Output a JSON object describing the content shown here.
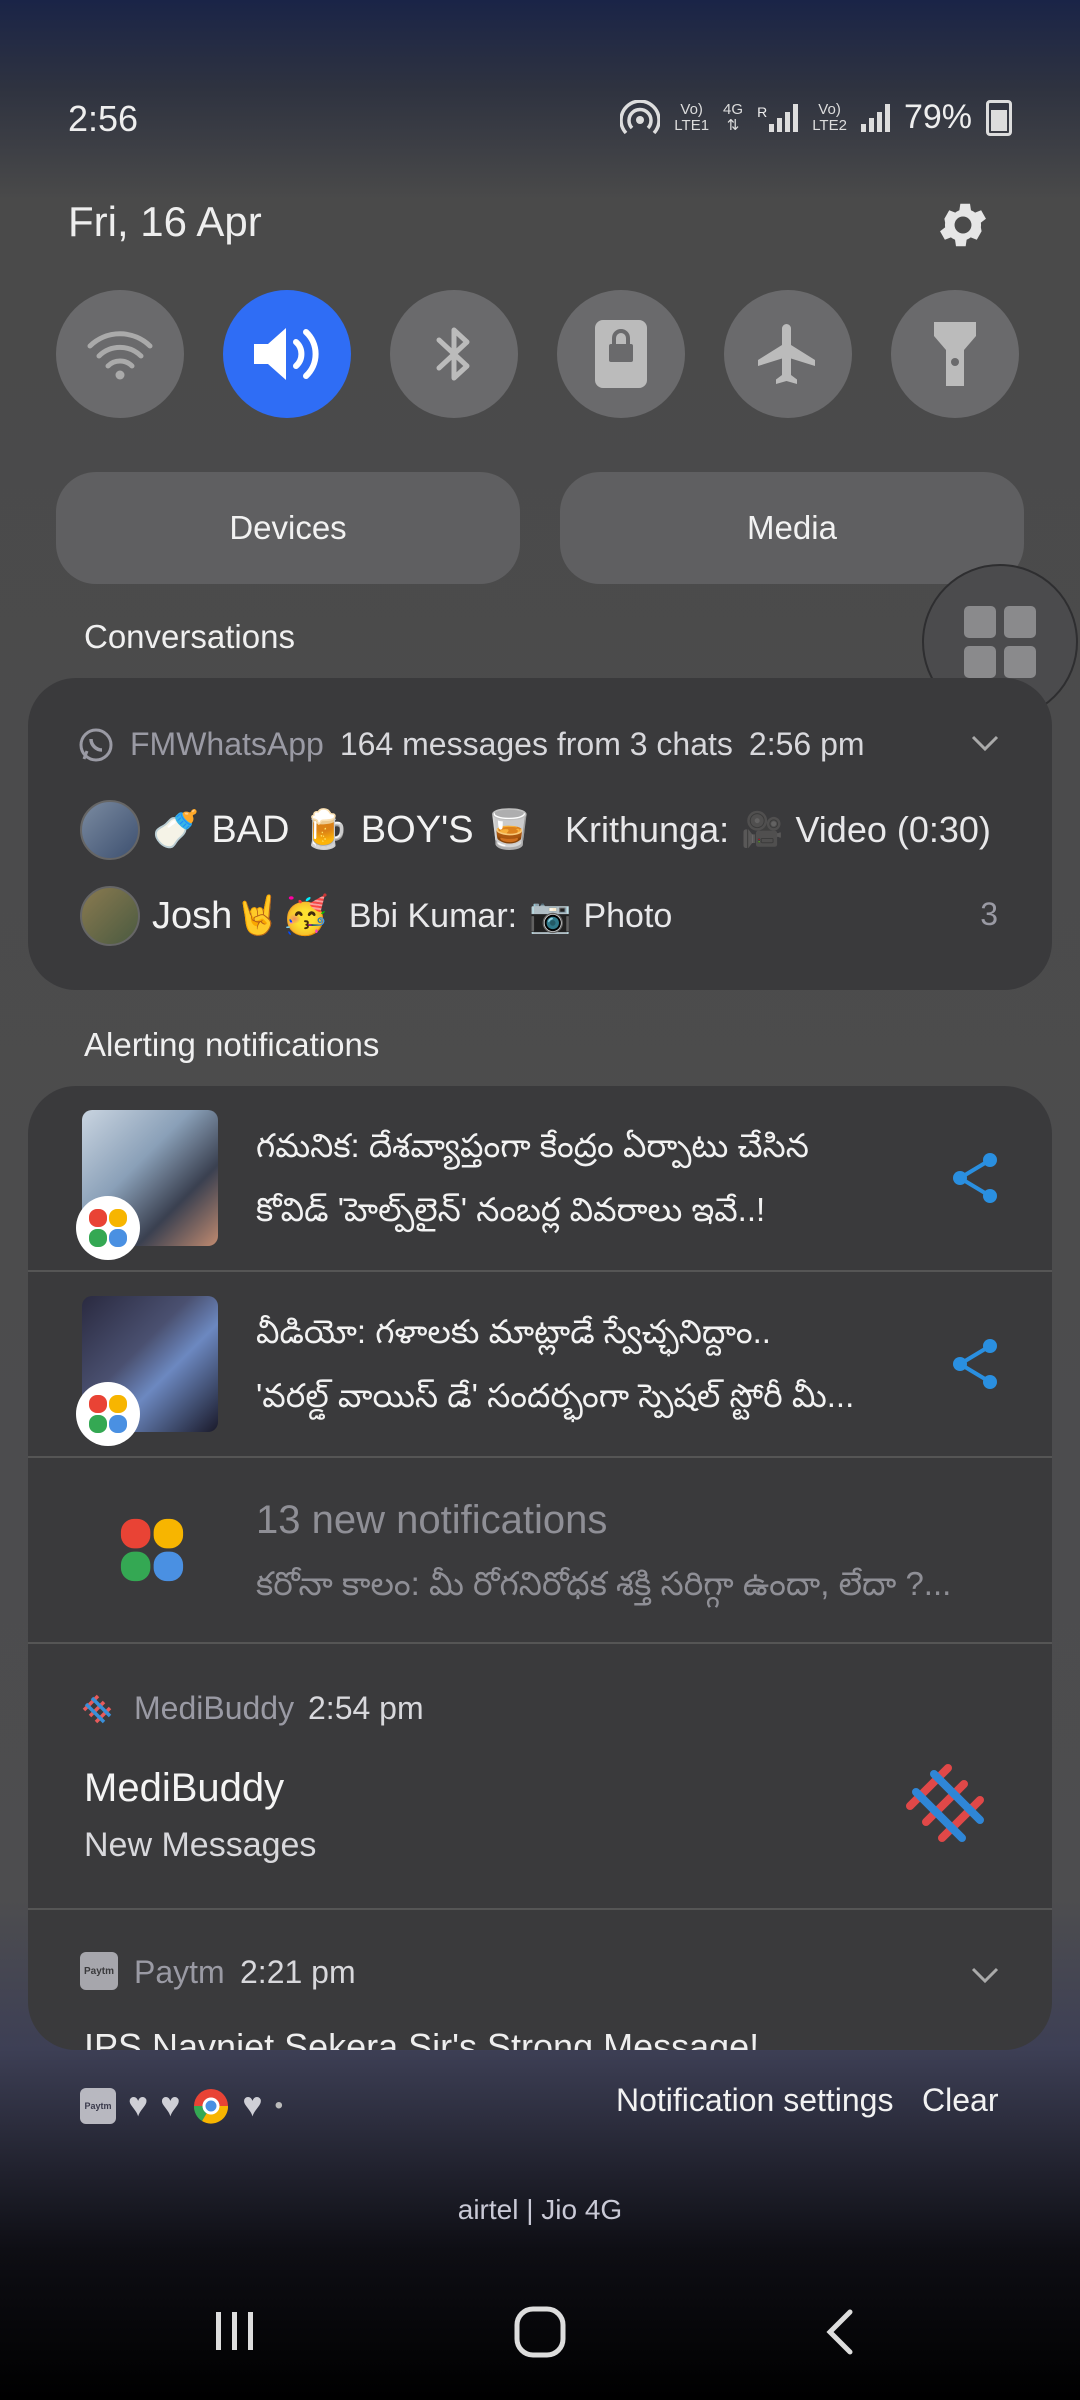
{
  "status_bar": {
    "time": "2:56",
    "sim1_top": "Vo)",
    "sim1_bottom": "LTE1",
    "net_type": "4G",
    "roaming": "R",
    "sim2_top": "Vo)",
    "sim2_bottom": "LTE2",
    "battery": "79%"
  },
  "header": {
    "date": "Fri, 16 Apr"
  },
  "quick_settings": {
    "tiles": [
      {
        "name": "wifi",
        "icon": "wifi-icon",
        "active": false
      },
      {
        "name": "sound",
        "icon": "volume-icon",
        "active": true
      },
      {
        "name": "bluetooth",
        "icon": "bluetooth-icon",
        "active": false
      },
      {
        "name": "screen-lock",
        "icon": "lock-icon",
        "active": false
      },
      {
        "name": "airplane",
        "icon": "airplane-icon",
        "active": false
      },
      {
        "name": "flashlight",
        "icon": "flashlight-icon",
        "active": false
      }
    ],
    "devices_label": "Devices",
    "media_label": "Media"
  },
  "conversations": {
    "label": "Conversations",
    "app": "FMWhatsApp",
    "summary": "164 messages from 3 chats",
    "time": "2:56 pm",
    "row1": {
      "group_a": "BAD",
      "group_b": "BOY'S",
      "sender": "Krithunga:",
      "message": "Video (0:30)"
    },
    "row2": {
      "name": "Josh",
      "sender": "Bbi Kumar:",
      "message": "Photo",
      "count": "3"
    }
  },
  "alerting": {
    "label": "Alerting notifications",
    "items": [
      {
        "line1": "గమనిక: దేశవ్యాప్తంగా కేంద్రం ఏర్పాటు చేసిన",
        "line2": "కోవిడ్ 'హెల్ప్‌లైన్' నంబర్ల వివరాలు ఇవే..!"
      },
      {
        "line1": "వీడియో: గళాలకు మాట్లాడే స్వేచ్ఛనిద్దాం..",
        "line2": "'వరల్డ్ వాయిస్ డే' సందర్భంగా స్పెషల్ స్టోరీ మీ..."
      }
    ],
    "group_title": "13 new notifications",
    "group_preview": "కరోనా కాలం: మీ రోగనిరోధక శక్తి సరిగ్గా ఉందా, లేదా ?...",
    "medibuddy": {
      "app": "MediBuddy",
      "time": "2:54 pm",
      "title": "MediBuddy",
      "body": "New Messages"
    },
    "paytm": {
      "app": "Paytm",
      "time": "2:21 pm",
      "badge": "Paytm",
      "preview": "IPS Navniet Sekera Sir's Strong Message!"
    }
  },
  "footer": {
    "notification_settings": "Notification settings",
    "clear": "Clear",
    "carrier": "airtel | Jio 4G"
  },
  "colors": {
    "accent": "#2f6df5",
    "share": "#2a8fe0",
    "card": "#3a3a3c"
  }
}
